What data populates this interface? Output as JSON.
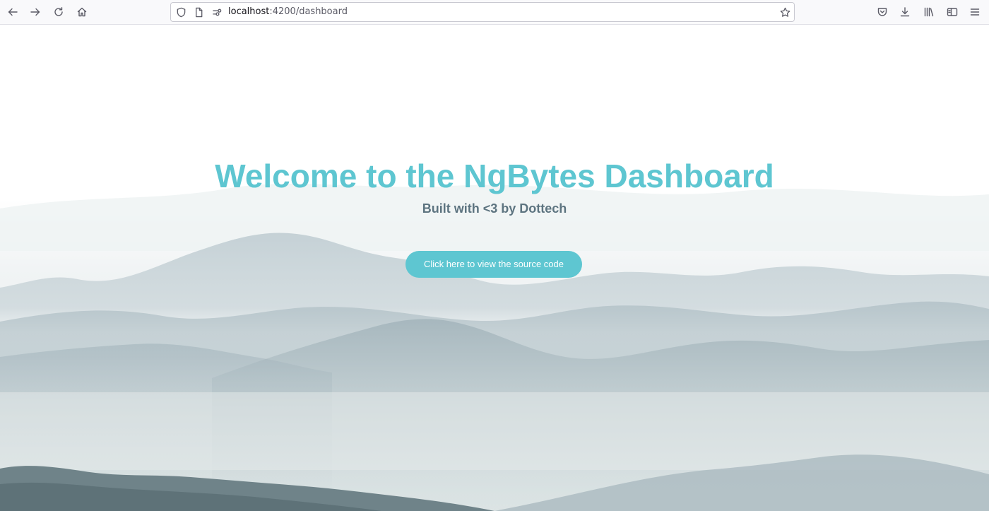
{
  "browser": {
    "url_host": "localhost",
    "url_path": ":4200/dashboard",
    "nav_icons": [
      "back-arrow-icon",
      "forward-arrow-icon",
      "reload-icon",
      "home-icon"
    ],
    "urlbar_icons": [
      "shield-icon",
      "page-icon",
      "permissions-icon",
      "bookmark-star-icon"
    ],
    "toolbar_icons": [
      "pocket-icon",
      "download-icon",
      "library-icon",
      "sidebar-icon",
      "menu-icon"
    ]
  },
  "hero": {
    "title": "Welcome to the NgBytes Dashboard",
    "subtitle": "Built with <3 by Dottech",
    "button_label": "Click here to view the source code"
  },
  "colors": {
    "accent": "#5ec6d1",
    "subtitle": "#5d7480",
    "background": "#ffffff"
  }
}
